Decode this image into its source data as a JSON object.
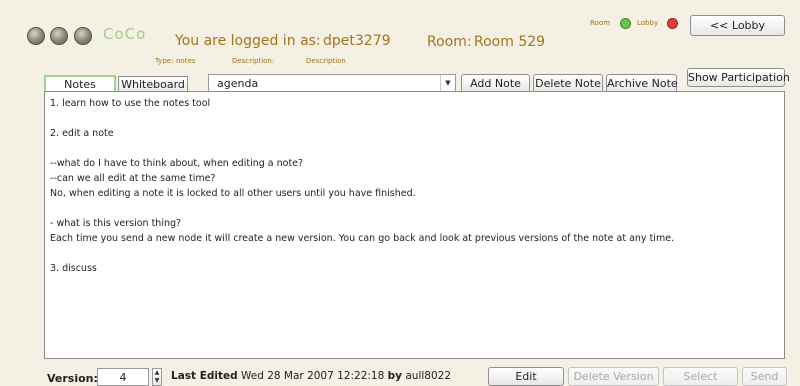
{
  "header": {
    "app_name": "CoCo",
    "logged_in_label": "You are logged in as:",
    "username": "dpet3279",
    "room_label": "Room:",
    "room_name": "Room 529",
    "type_label": "Type:",
    "type_value": "notes",
    "description_label": "Description:",
    "description_value": "Description",
    "status_room_label": "Room",
    "status_lobby_label": "Lobby",
    "status_room_color": "#6cc24a",
    "status_lobby_color": "#e23c3c",
    "lobby_button": "<< Lobby"
  },
  "tabs": [
    {
      "label": "Notes",
      "active": true
    },
    {
      "label": "Whiteboard",
      "active": false
    }
  ],
  "toolbar": {
    "note_select_value": "agenda",
    "add_note": "Add Note",
    "delete_note": "Delete Note",
    "archive_note": "Archive Note",
    "show_participation": "Show Participation"
  },
  "note_lines": [
    "1. learn how to use the notes tool",
    "",
    "2. edit a note",
    "",
    "--what do I have to think about, when editing a note?",
    "--can we all edit at the same time?",
    "No, when editing a note it is locked to all other users until you have finished.",
    "",
    "- what is this version thing?",
    "Each time you send a new node it will create a new version. You can go back and look at previous versions of the note at any time.",
    "",
    "3. discuss"
  ],
  "footer": {
    "version_label": "Version:",
    "version_value": "4",
    "last_edited_label": "Last Edited",
    "last_edited_date": "Wed 28 Mar 2007 12:22:18",
    "by_label": "by",
    "editor": "aull8022",
    "edit_button": "Edit",
    "delete_version_button": "Delete Version",
    "select_button": "Select",
    "send_button": "Send"
  },
  "colors": {
    "background": "#f4f0e3",
    "accent_brown": "#a5731c",
    "logo_green": "#9fd08a",
    "active_tab_border": "#9ed48e"
  }
}
